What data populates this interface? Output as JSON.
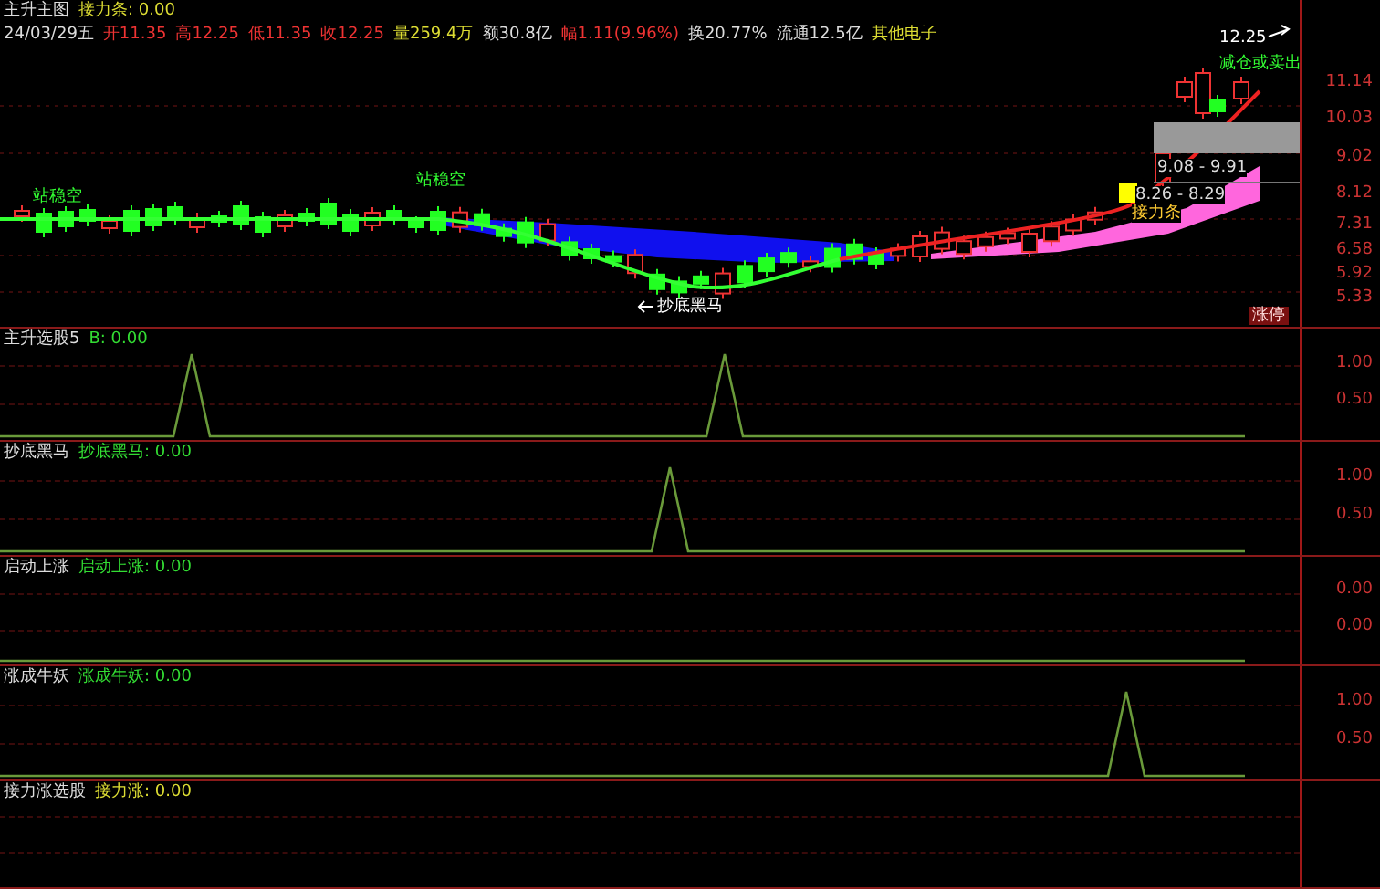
{
  "header": {
    "items": [
      "主升主图",
      "接力条: 0.00"
    ]
  },
  "quote": [
    {
      "text": "24/03/29五",
      "kind": "date"
    },
    {
      "text": "开11.35",
      "kind": "up"
    },
    {
      "text": "高12.25",
      "kind": "up"
    },
    {
      "text": "低11.35",
      "kind": "up"
    },
    {
      "text": "收12.25",
      "kind": "up"
    },
    {
      "text": "量259.4万",
      "kind": "volume"
    },
    {
      "text": "额30.8亿",
      "kind": "plain"
    },
    {
      "text": "幅1.11(9.96%)",
      "kind": "up"
    },
    {
      "text": "换20.77%",
      "kind": "plain"
    },
    {
      "text": "流通12.5亿",
      "kind": "plain"
    },
    {
      "text": "其他电子",
      "kind": "sector"
    }
  ],
  "main_chart": {
    "price_ticks": [
      "11.14",
      "10.03",
      "9.02",
      "8.12",
      "7.31",
      "6.58",
      "5.92",
      "5.33"
    ],
    "annotations": [
      {
        "kind": "high",
        "text": "12.25"
      },
      {
        "kind": "sell",
        "text": "减仓或卖出"
      },
      {
        "kind": "zone",
        "text": "9.08 - 9.91"
      },
      {
        "kind": "zone-low",
        "text": "8.26 - 8.29"
      },
      {
        "kind": "relay",
        "text": "接力条"
      },
      {
        "kind": "bottom",
        "text": "抄底黑马"
      },
      {
        "kind": "station",
        "text": "站稳空"
      },
      {
        "kind": "station",
        "text": "站稳空"
      },
      {
        "kind": "limit",
        "text": "涨停"
      }
    ]
  },
  "panels": [
    {
      "name": "主升选股5",
      "value": "B: 0.00",
      "color": "#33dd33",
      "ticks": [
        "1.00",
        "0.50"
      ]
    },
    {
      "name": "抄底黑马",
      "value": "抄底黑马: 0.00",
      "color": "#33dd33",
      "ticks": [
        "1.00",
        "0.50"
      ]
    },
    {
      "name": "启动上涨",
      "value": "启动上涨: 0.00",
      "color": "#33dd33",
      "ticks": [
        "0.00",
        "0.00"
      ]
    },
    {
      "name": "涨成牛妖",
      "value": "涨成牛妖: 0.00",
      "color": "#33dd33",
      "ticks": [
        "1.00",
        "0.50"
      ]
    },
    {
      "name": "接力涨选股",
      "value": "接力涨: 0.00",
      "color": "#dddd33"
    }
  ]
}
